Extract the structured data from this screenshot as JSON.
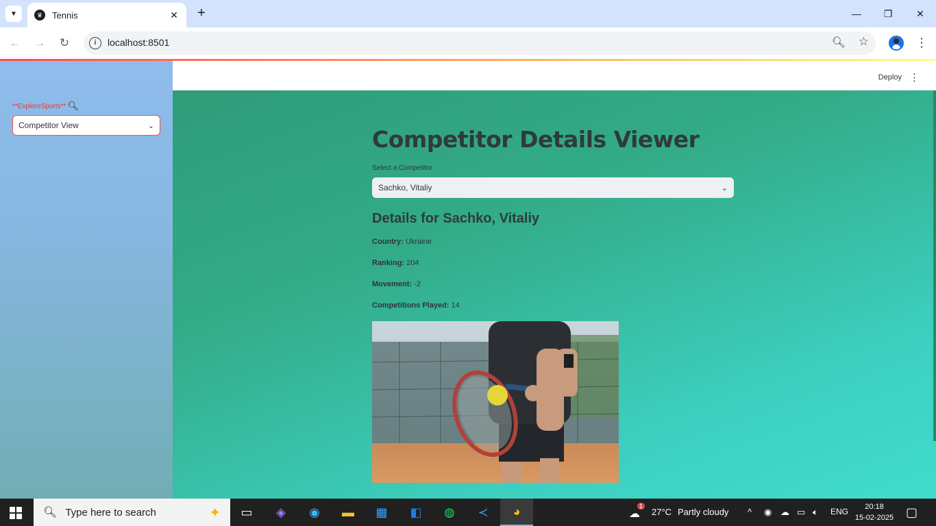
{
  "browser": {
    "tab_title": "Tennis",
    "tab_close": "✕",
    "new_tab": "+",
    "url": "localhost:8501",
    "window_controls": {
      "minimize": "—",
      "restore": "❐",
      "close": "✕"
    }
  },
  "sidebar": {
    "label_prefix": "**",
    "label_text": "ExploreSports",
    "label_suffix": "**",
    "label_icon": "magnifier-icon",
    "select_value": "Competitor View"
  },
  "header": {
    "deploy_label": "Deploy"
  },
  "main": {
    "title": "Competitor Details Viewer",
    "select_label": "Select a Competitor",
    "select_value": "Sachko, Vitaliy",
    "details_heading": "Details for Sachko, Vitaliy",
    "fields": [
      {
        "label": "Country:",
        "value": "Ukraine"
      },
      {
        "label": "Ranking:",
        "value": "204"
      },
      {
        "label": "Movement:",
        "value": "-2"
      },
      {
        "label": "Competitions Played:",
        "value": "14"
      }
    ]
  },
  "taskbar": {
    "search_placeholder": "Type here to search",
    "weather_temp": "27°C",
    "weather_text": "Partly cloudy",
    "language": "ENG",
    "time": "20:18",
    "date": "15-02-2025",
    "weather_badge": "1"
  },
  "colors": {
    "accent": "#ff4b4b",
    "main_gradient_start": "#2f9c78",
    "main_gradient_end": "#42dccd",
    "sidebar_top": "#8fbcec"
  }
}
